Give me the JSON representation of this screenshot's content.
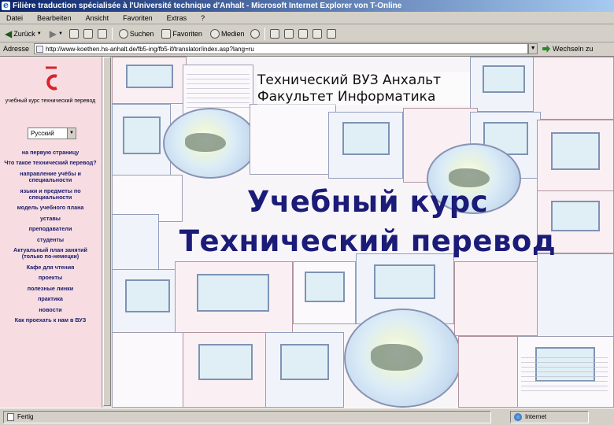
{
  "window": {
    "title": "Filière traduction spécialisée à l'Université technique d'Anhalt - Microsoft Internet Explorer von T-Online"
  },
  "menu": [
    "Datei",
    "Bearbeiten",
    "Ansicht",
    "Favoriten",
    "Extras",
    "?"
  ],
  "toolbar": {
    "back": "Zurück",
    "search": "Suchen",
    "favorites": "Favoriten",
    "media": "Medien"
  },
  "address": {
    "label": "Adresse",
    "url": "http://www-koethen.hs-anhalt.de/fb5-ing/fb5-if/translator/index.asp?lang=ru",
    "go": "Wechseln zu"
  },
  "left": {
    "logo_caption": "учебный курс технический перевод",
    "language": "Русский",
    "nav": [
      "на первую страницу",
      "Что такое технический перевод?",
      "направление учёбы и специальности",
      "языки и предметы по специальности",
      "модель учебного плана",
      "уставы",
      "преподаватели",
      "студенты",
      "Актуальный план занятий (только по-немецки)",
      "Кафе для чтения",
      "проекты",
      "полезные линки",
      "практика",
      "новости",
      "Как проехать к нам в ВУЗ"
    ]
  },
  "main": {
    "university_line1": "Технический ВУЗ Анхальт",
    "university_line2": "Факультет Информатика",
    "course_line1": "Учебный курс",
    "course_line2": "Технический перевод"
  },
  "status": {
    "text": "Fertig",
    "zone": "Internet"
  },
  "colors": {
    "title_gradient_start": "#0a246a",
    "left_frame_bg": "#f7dde2",
    "course_title": "#1b1b78",
    "logo_red": "#d8232a"
  }
}
